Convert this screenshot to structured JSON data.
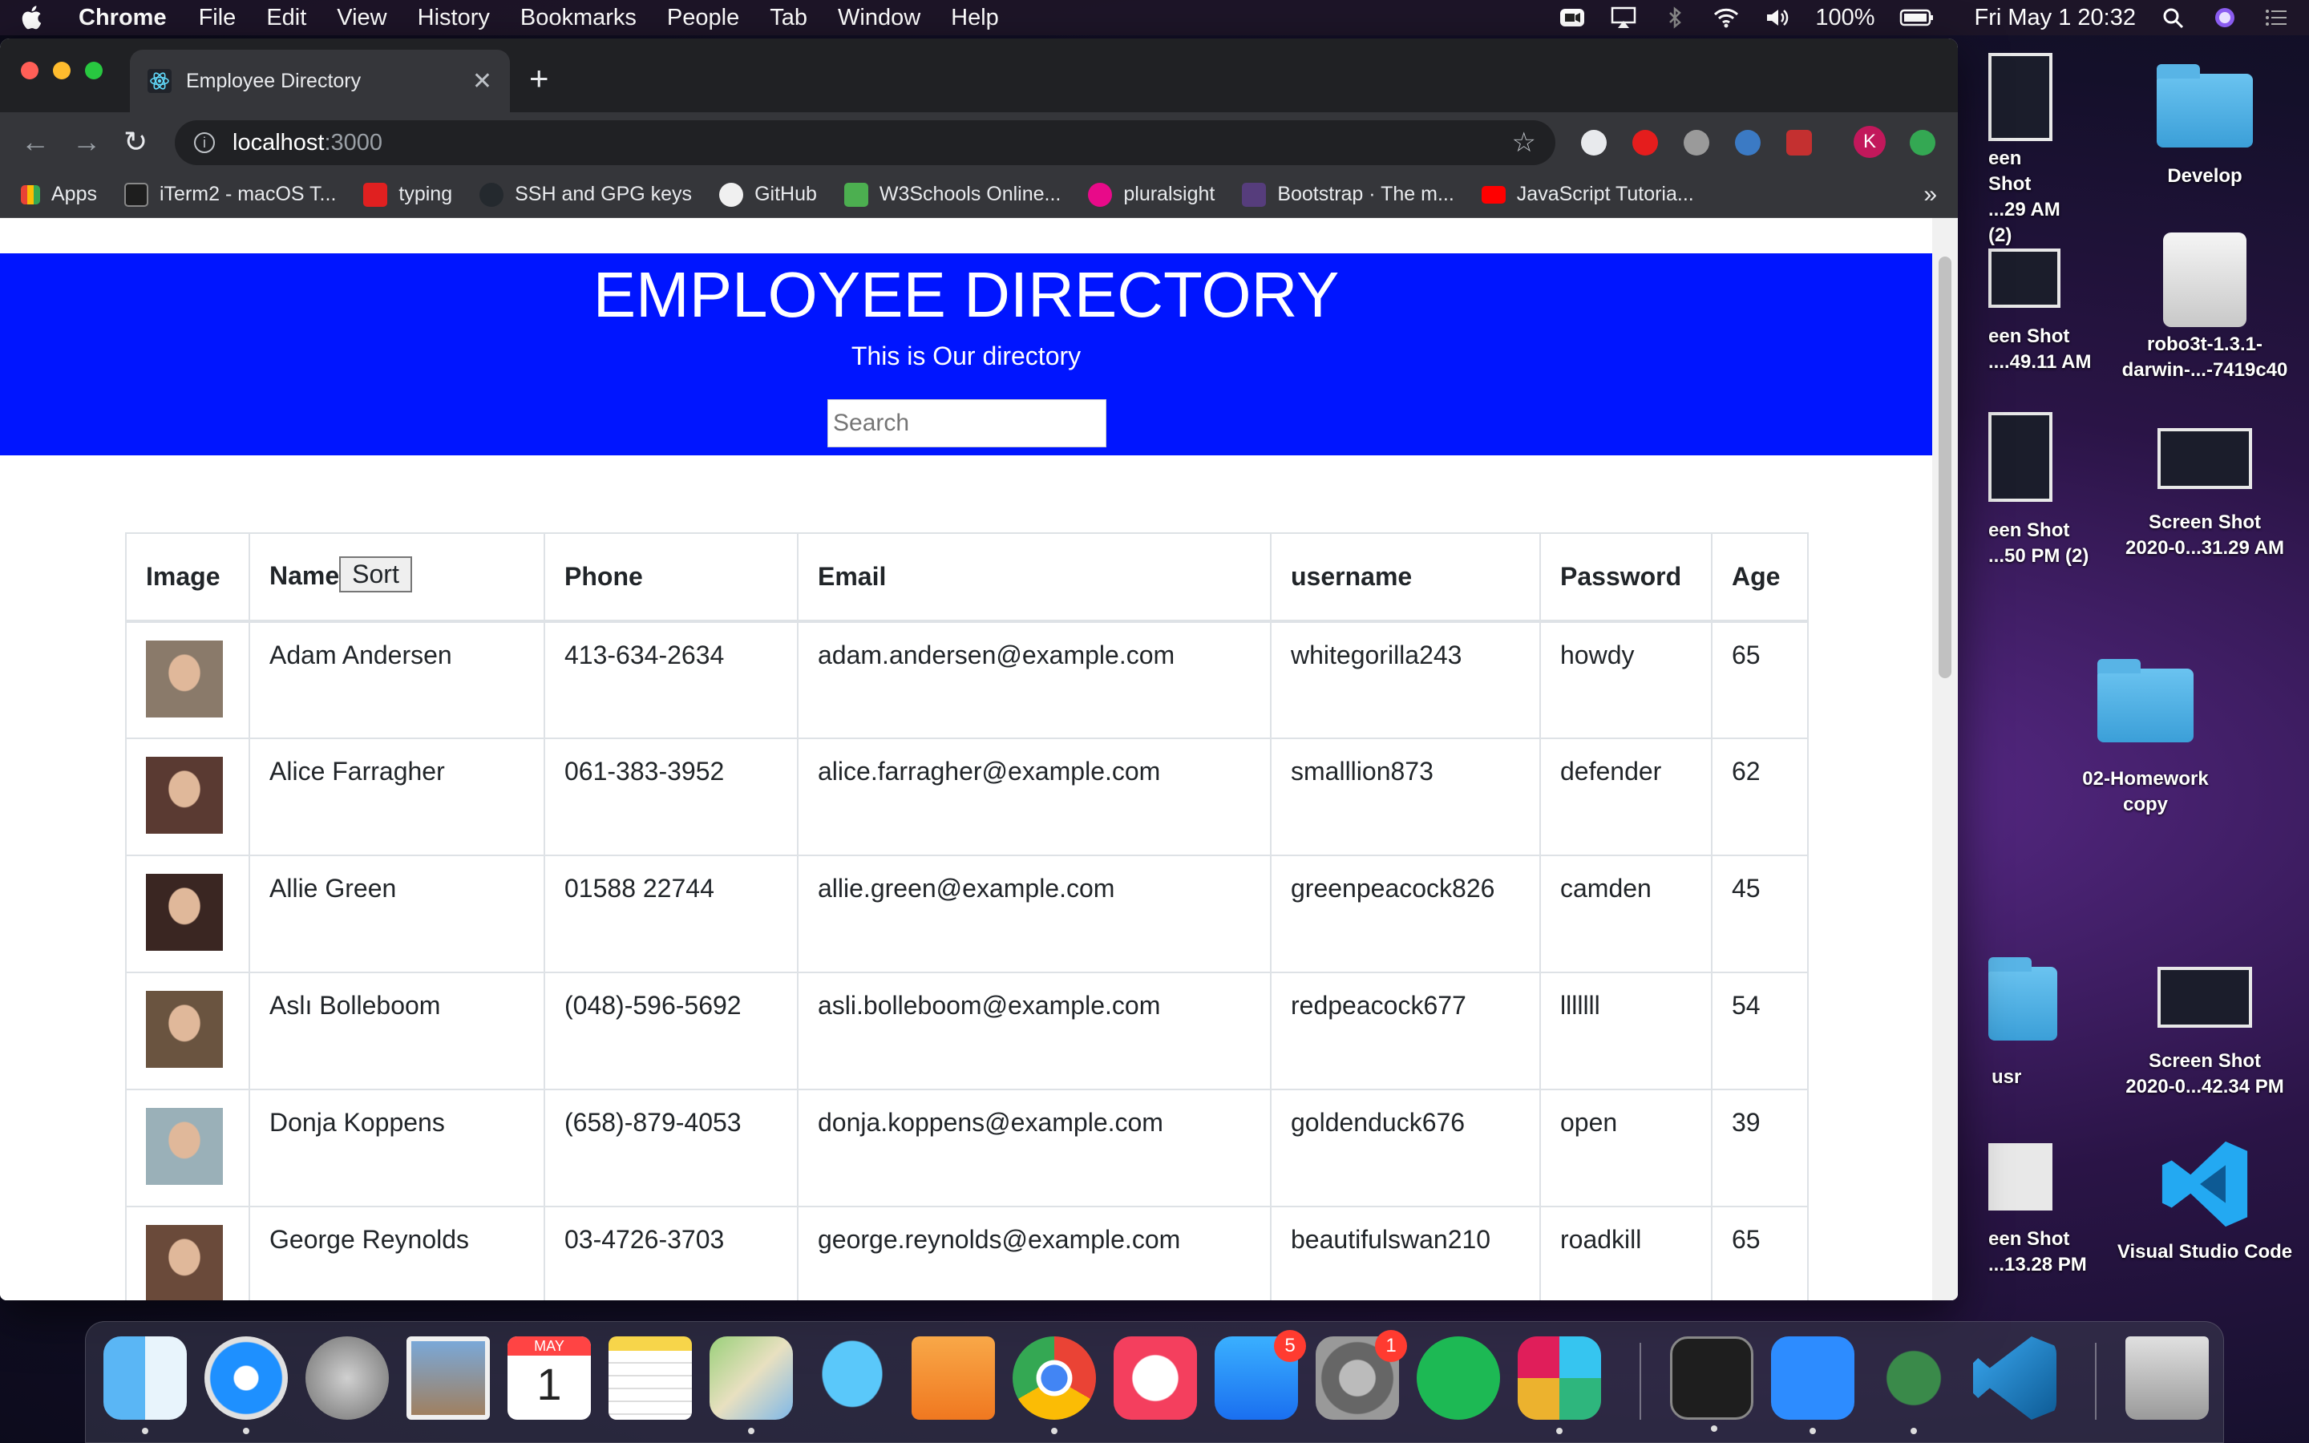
{
  "menubar": {
    "app_name": "Chrome",
    "items": [
      "File",
      "Edit",
      "View",
      "History",
      "Bookmarks",
      "People",
      "Tab",
      "Window",
      "Help"
    ],
    "battery": "100%",
    "datetime": "Fri May 1  20:32"
  },
  "browser": {
    "tab_title": "Employee Directory",
    "url_host": "localhost",
    "url_port": ":3000",
    "bookmarks": [
      "Apps",
      "iTerm2 - macOS T...",
      "typing",
      "SSH and GPG keys",
      "GitHub",
      "W3Schools Online...",
      "pluralsight",
      "Bootstrap · The m...",
      "JavaScript Tutoria..."
    ],
    "profile_initial": "K"
  },
  "page": {
    "title": "EMPLOYEE DIRECTORY",
    "subtitle": "This is Our directory",
    "search_placeholder": "Search",
    "headers": {
      "image": "Image",
      "name": "Name",
      "sort": "Sort",
      "phone": "Phone",
      "email": "Email",
      "username": "username",
      "password": "Password",
      "age": "Age"
    },
    "rows": [
      {
        "name": "Adam Andersen",
        "phone": "413-634-2634",
        "email": "adam.andersen@example.com",
        "username": "whitegorilla243",
        "password": "howdy",
        "age": "65",
        "avatar_color": "#8a7a6a"
      },
      {
        "name": "Alice Farragher",
        "phone": "061-383-3952",
        "email": "alice.farragher@example.com",
        "username": "smalllion873",
        "password": "defender",
        "age": "62",
        "avatar_color": "#5a3a32"
      },
      {
        "name": "Allie Green",
        "phone": "01588 22744",
        "email": "allie.green@example.com",
        "username": "greenpeacock826",
        "password": "camden",
        "age": "45",
        "avatar_color": "#3a2622"
      },
      {
        "name": "Aslı Bolleboom",
        "phone": "(048)-596-5692",
        "email": "asli.bolleboom@example.com",
        "username": "redpeacock677",
        "password": "lllllll",
        "age": "54",
        "avatar_color": "#6a5440"
      },
      {
        "name": "Donja Koppens",
        "phone": "(658)-879-4053",
        "email": "donja.koppens@example.com",
        "username": "goldenduck676",
        "password": "open",
        "age": "39",
        "avatar_color": "#9ab0b8"
      },
      {
        "name": "George Reynolds",
        "phone": "03-4726-3703",
        "email": "george.reynolds@example.com",
        "username": "beautifulswan210",
        "password": "roadkill",
        "age": "65",
        "avatar_color": "#6a4a3a"
      }
    ]
  },
  "desktop": {
    "icons": [
      {
        "label1": "een Shot",
        "label2": "...29 AM (2)"
      },
      {
        "label1": "Develop",
        "label2": ""
      },
      {
        "label1": "een Shot",
        "label2": "....49.11 AM"
      },
      {
        "label1": "robo3t-1.3.1-",
        "label2": "darwin-...-7419c40"
      },
      {
        "label1": "een Shot",
        "label2": "...50 PM (2)"
      },
      {
        "label1": "Screen Shot",
        "label2": "2020-0...31.29 AM"
      },
      {
        "label1": "02-Homework",
        "label2": "copy"
      },
      {
        "label1": "usr",
        "label2": ""
      },
      {
        "label1": "Screen Shot",
        "label2": "2020-0...42.34 PM"
      },
      {
        "label1": "een Shot",
        "label2": "...13.28 PM"
      },
      {
        "label1": "Visual Studio Code",
        "label2": ""
      }
    ]
  },
  "dock": {
    "calendar_month": "MAY",
    "calendar_day": "1",
    "appstore_badge": "5",
    "settings_badge": "1"
  }
}
